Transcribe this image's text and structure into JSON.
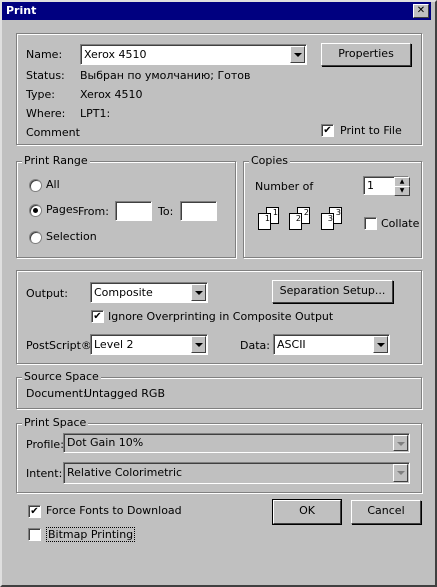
{
  "window": {
    "title": "Print",
    "close_glyph": "✕"
  },
  "printer": {
    "name_label": "Name:",
    "name_value": "Xerox 4510",
    "properties_label": "Properties",
    "status_label": "Status:",
    "status_value": "Выбран по умолчанию; Готов",
    "type_label": "Type:",
    "type_value": "Xerox 4510",
    "where_label": "Where:",
    "where_value": "LPT1:",
    "comment_label": "Comment",
    "print_to_file_label": "Print to File",
    "print_to_file_checked": true
  },
  "print_range": {
    "legend": "Print Range",
    "all_label": "All",
    "pages_label": "Pages",
    "from_label": "From:",
    "to_label": "To:",
    "from_value": "",
    "to_value": "",
    "selection_label": "Selection",
    "selected": "pages"
  },
  "copies": {
    "legend": "Copies",
    "number_label": "Number of",
    "number_value": "1",
    "collate_label": "Collate",
    "collate_checked": false
  },
  "output": {
    "output_label": "Output:",
    "output_value": "Composite",
    "separation_setup_label": "Separation Setup...",
    "ignore_overprinting_label": "Ignore Overprinting in Composite Output",
    "ignore_overprinting_checked": true,
    "postscript_label": "PostScript®",
    "postscript_value": "Level 2",
    "data_label": "Data:",
    "data_value": "ASCII"
  },
  "source_space": {
    "legend": "Source Space",
    "document_label": "Document:",
    "document_value": "Untagged RGB"
  },
  "print_space": {
    "legend": "Print Space",
    "profile_label": "Profile:",
    "profile_value": "Dot Gain 10%",
    "intent_label": "Intent:",
    "intent_value": "Relative Colorimetric"
  },
  "options": {
    "force_fonts_label": "Force Fonts to Download",
    "force_fonts_checked": true,
    "bitmap_printing_label": "Bitmap Printing",
    "bitmap_printing_checked": false
  },
  "buttons": {
    "ok_label": "OK",
    "cancel_label": "Cancel"
  }
}
